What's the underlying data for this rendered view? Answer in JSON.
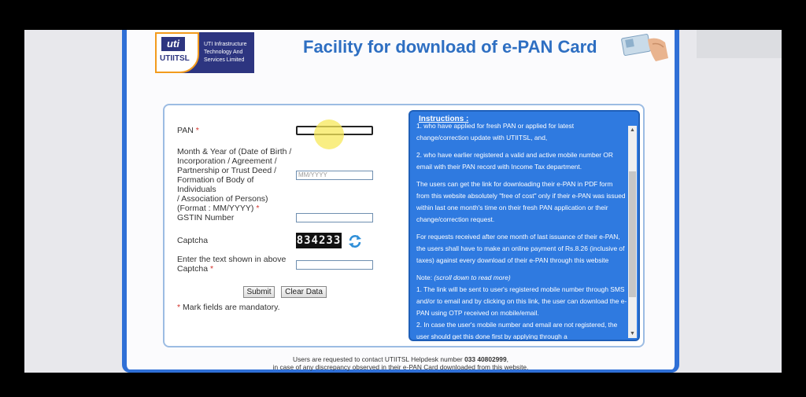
{
  "header": {
    "logo_uti": "uti",
    "logo_utiitsl": "UTIITSL",
    "logo_line1": "UTI  Infrastructure",
    "logo_line2": "Technology   And",
    "logo_line3": "Services    Limited",
    "title": "Facility for download of e-PAN Card"
  },
  "form": {
    "pan_label": "PAN",
    "dob_label_lines": [
      "Month & Year of (Date of Birth /",
      "Incorporation / Agreement /",
      "Partnership or Trust Deed /",
      "Formation of Body of Individuals",
      "/ Association of Persons)",
      "(Format : MM/YYYY)"
    ],
    "dob_placeholder": "MM/YYYY",
    "gstin_label": "GSTIN Number",
    "captcha_label": "Captcha",
    "captcha_value": "834233",
    "captcha_input_label_lines": [
      "Enter the text shown in above",
      "Captcha"
    ],
    "required_mark": "*",
    "submit_label": "Submit",
    "clear_label": "Clear Data",
    "mandatory_note": "Mark fields are mandatory."
  },
  "instructions": {
    "title": "Instructions :",
    "paragraphs": [
      "1. who have applied for fresh PAN or applied for latest change/correction update with UTIITSL, and,",
      "2. who have earlier registered a valid and active mobile number OR email with their PAN record with Income Tax department.",
      "The users can get the link for downloading their e-PAN in PDF form from this website absolutely \"free of cost\" only if their e-PAN was issued within last one month's time on their fresh PAN application or their change/correction request.",
      "For requests received after one month of last issuance of their e-PAN, the users shall have to make an online payment of Rs.8.26 (inclusive of taxes) against every download of their e-PAN through this website"
    ],
    "note_label": "Note:",
    "note_italic": "(scroll down to read more)",
    "note_items": [
      "1. The link will be sent to user's registered mobile number through SMS and/or to email and by clicking on this link, the user can download the e-PAN using OTP received on mobile/email.",
      "2. In case the user's mobile number and email are not registered, the user should get this done first by applying through a"
    ]
  },
  "footer": {
    "line1_prefix": "Users are requested to contact UTIITSL Helpdesk number ",
    "line1_number": "033 40802999",
    "line1_suffix": ",",
    "line2": "in case of any discrepancy observed in their e-PAN Card downloaded from this website."
  },
  "colors": {
    "accent_blue": "#2f6fd6",
    "title_blue": "#2e6fc2",
    "required_red": "#d2332b",
    "instruction_bg": "#2f7ae0"
  }
}
